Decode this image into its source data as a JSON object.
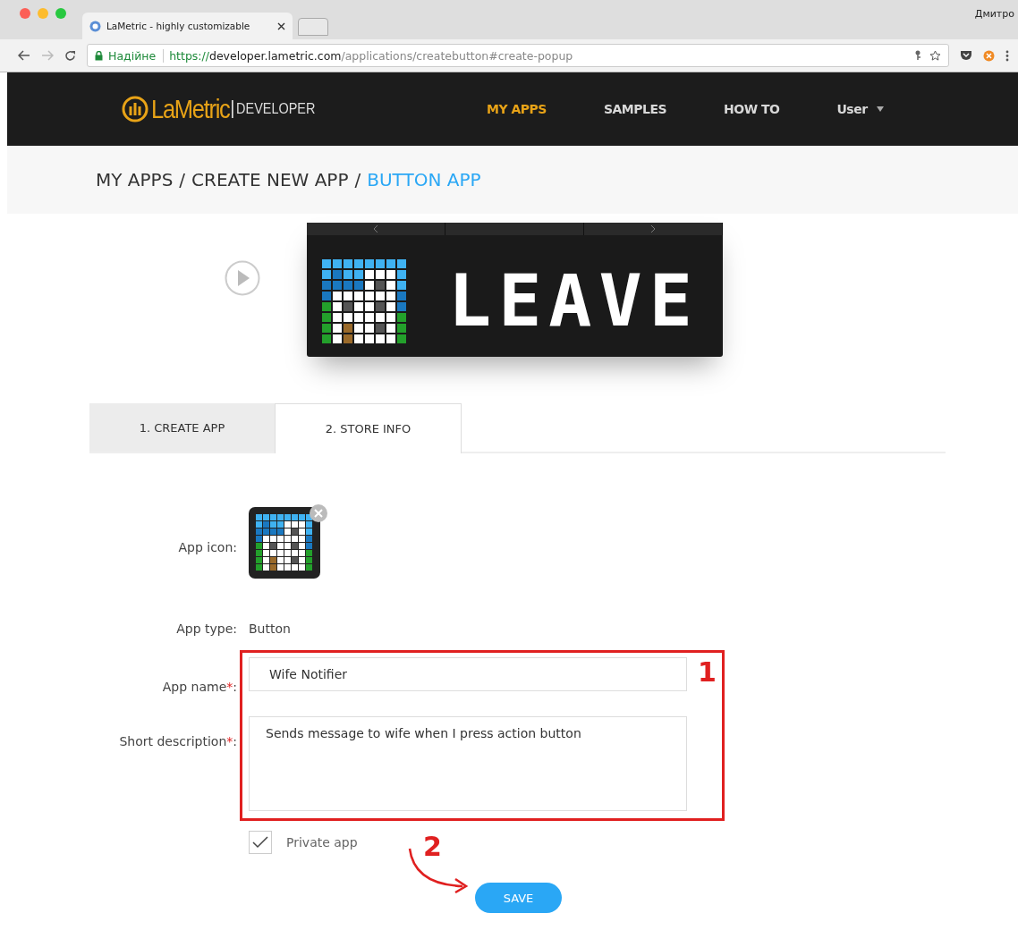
{
  "browser": {
    "tab_title": "LaMetric - highly customizable",
    "profile": "Дмитро",
    "secure_label": "Надійне",
    "url_scheme": "https://",
    "url_host": "developer.lametric.com",
    "url_path": "/applications/createbutton#create-popup"
  },
  "nav": {
    "logo": "LaMetric",
    "logo_sub": "DEVELOPER",
    "user": "User",
    "items": [
      {
        "label": "MY APPS",
        "selected": true
      },
      {
        "label": "SAMPLES",
        "selected": false
      },
      {
        "label": "HOW TO",
        "selected": false
      }
    ]
  },
  "breadcrumb": {
    "separator": "/",
    "items": [
      {
        "label": "MY APPS",
        "current": false
      },
      {
        "label": "CREATE NEW APP",
        "current": false
      },
      {
        "label": "BUTTON APP",
        "current": true
      }
    ]
  },
  "preview": {
    "display_text": "LEAVE"
  },
  "tabs": [
    {
      "label": "1. CREATE APP",
      "selected": false
    },
    {
      "label": "2. STORE INFO",
      "selected": true
    }
  ],
  "form": {
    "icon_label": "App icon:",
    "type_label": "App type:",
    "type_value": "Button",
    "required_mark": "*",
    "colon": ":",
    "name": {
      "label": "App name",
      "value": "Wife Notifier"
    },
    "description": {
      "label": "Short description",
      "value": "Sends message to wife when I press action button"
    },
    "private": {
      "label": "Private app",
      "checked": true
    },
    "save": "SAVE"
  },
  "annotations": [
    {
      "label": "1"
    },
    {
      "label": "2"
    }
  ]
}
